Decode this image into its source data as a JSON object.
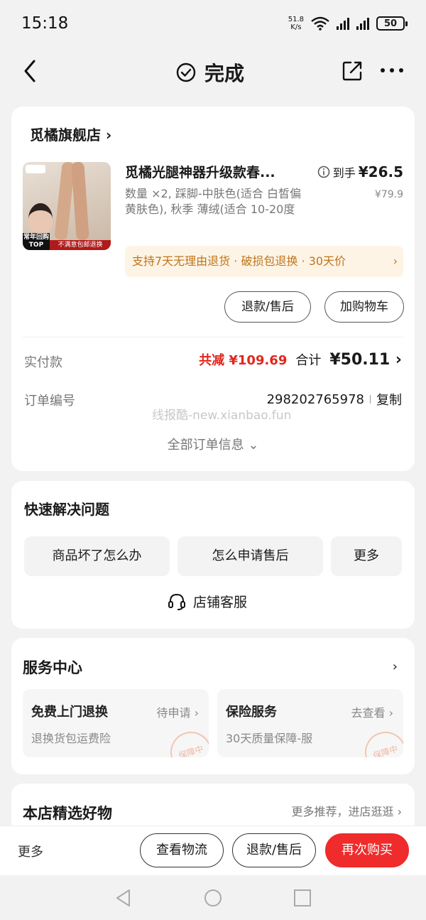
{
  "status": {
    "time": "15:18",
    "speed_value": "51.8",
    "speed_unit": "K/s",
    "battery": "50"
  },
  "nav": {
    "title": "完成"
  },
  "order": {
    "shop_name": "觅橘旗舰店 ›",
    "product_title": "觅橘光腿神器升级款春...",
    "price_label": "到手",
    "price_now": "¥26.5",
    "price_original": "¥79.9",
    "spec": "数量 ×2, 踩脚-中肤色(适合 白皙偏黄肤色), 秋季 薄绒(适合 10-20度",
    "service_text": "支持7天无理由退货 · 破损包退换 · 30天价",
    "service_chevron": "›",
    "thumb_badge_top": "常年回购 TOP",
    "thumb_badge_red": "不满意包邮退换",
    "refund_button": "退款/售后",
    "cart_button": "加购物车",
    "paid_label": "实付款",
    "discount": "共减 ¥109.69",
    "total_label": "合计",
    "total_value": "¥50.11 ›",
    "order_no_label": "订单编号",
    "order_no": "298202765978",
    "copy": "复制",
    "watermark": "线报酷-new.xianbao.fun",
    "all_info": "全部订单信息 ⌄"
  },
  "quick": {
    "title": "快速解决问题",
    "buttons": [
      "商品坏了怎么办",
      "怎么申请售后",
      "更多"
    ],
    "customer_service": "店铺客服"
  },
  "service_center": {
    "title": "服务中心",
    "chevron": "›",
    "items": [
      {
        "title": "免费上门退换",
        "status": "待申请 ›",
        "desc": "退换货包运费险",
        "stamp": "保障中"
      },
      {
        "title": "保险服务",
        "status": "去查看 ›",
        "desc": "30天质量保障-服",
        "stamp": "保障中"
      }
    ]
  },
  "recommend": {
    "title": "本店精选好物",
    "more": "更多推荐，进店逛逛 ›"
  },
  "bottom": {
    "more": "更多",
    "logistics": "查看物流",
    "refund": "退款/售后",
    "rebuy": "再次购买"
  },
  "colors": {
    "accent_red": "#ef2b2b",
    "discount_red": "#e2261c",
    "service_orange": "#c0751a"
  }
}
